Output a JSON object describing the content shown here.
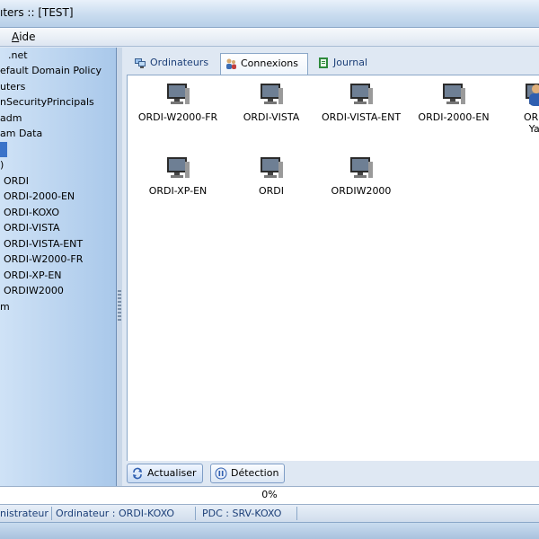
{
  "window": {
    "title": "ıters :: [TEST]"
  },
  "menu": {
    "items": [
      "Aide"
    ]
  },
  "tree": {
    "items": [
      {
        "label": ".net"
      },
      {
        "label": "efault Domain Policy"
      },
      {
        "label": "uters"
      },
      {
        "label": "nSecurityPrincipals"
      },
      {
        "label": "adm"
      },
      {
        "label": "am Data"
      },
      {
        "label": "",
        "selected": true
      },
      {
        "label": ")"
      },
      {
        "label": "ORDI"
      },
      {
        "label": "ORDI-2000-EN"
      },
      {
        "label": "ORDI-KOXO"
      },
      {
        "label": "ORDI-VISTA"
      },
      {
        "label": "ORDI-VISTA-ENT"
      },
      {
        "label": "ORDI-W2000-FR"
      },
      {
        "label": "ORDI-XP-EN"
      },
      {
        "label": "ORDIW2000"
      },
      {
        "label": "m"
      }
    ]
  },
  "tabs": [
    {
      "label": "Ordinateurs",
      "icon": "computers-icon",
      "active": false
    },
    {
      "label": "Connexions",
      "icon": "users-icon",
      "active": true
    },
    {
      "label": "Journal",
      "icon": "log-icon",
      "active": false
    }
  ],
  "computers": [
    {
      "label": "ORDI-W2000-FR"
    },
    {
      "label": "ORDI-VISTA"
    },
    {
      "label": "ORDI-VISTA-ENT"
    },
    {
      "label": "ORDI-2000-EN"
    },
    {
      "label": "ORDI",
      "sublabel": "Yar",
      "user": true
    },
    {
      "label": "ORDI-XP-EN"
    },
    {
      "label": "ORDI"
    },
    {
      "label": "ORDIW2000"
    }
  ],
  "buttons": {
    "refresh": {
      "label": "Actualiser",
      "icon": "refresh-icon"
    },
    "detect": {
      "label": "Détection",
      "icon": "pause-icon"
    }
  },
  "progress": {
    "text": "0%",
    "value": 0
  },
  "status": {
    "user": "nistrateur",
    "computer": "Ordinateur : ORDI-KOXO",
    "pdc": "PDC : SRV-KOXO"
  },
  "colors": {
    "selection": "#3a73c9",
    "tree_bg": "#b9d3ee",
    "link_text": "#1c3f78"
  }
}
